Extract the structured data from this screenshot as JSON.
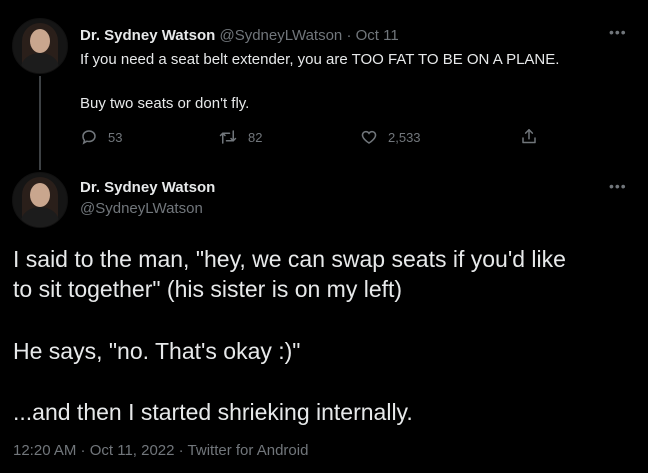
{
  "tweet1": {
    "author_name": "Dr. Sydney Watson",
    "handle": "@SydneyLWatson",
    "date": "Oct 11",
    "line1": "If you need a seat belt extender, you are TOO FAT TO BE ON A PLANE.",
    "line2": "Buy two seats or don't fly.",
    "reply_count": "53",
    "retweet_count": "82",
    "like_count": "2,533"
  },
  "tweet2": {
    "author_name": "Dr. Sydney Watson",
    "handle": "@SydneyLWatson",
    "para1_line1": "I said to the man, \"hey, we can swap seats if you'd like",
    "para1_line2": "to sit together\" (his sister is on my left)",
    "para2": "He says, \"no. That's okay :)\"",
    "para3": "...and then I started shrieking internally.",
    "timestamp": "12:20 AM · Oct 11, 2022 · Twitter for Android"
  },
  "icons": {
    "reply": "reply-icon",
    "retweet": "retweet-icon",
    "like": "heart-icon",
    "share": "share-icon",
    "more": "more-icon"
  }
}
